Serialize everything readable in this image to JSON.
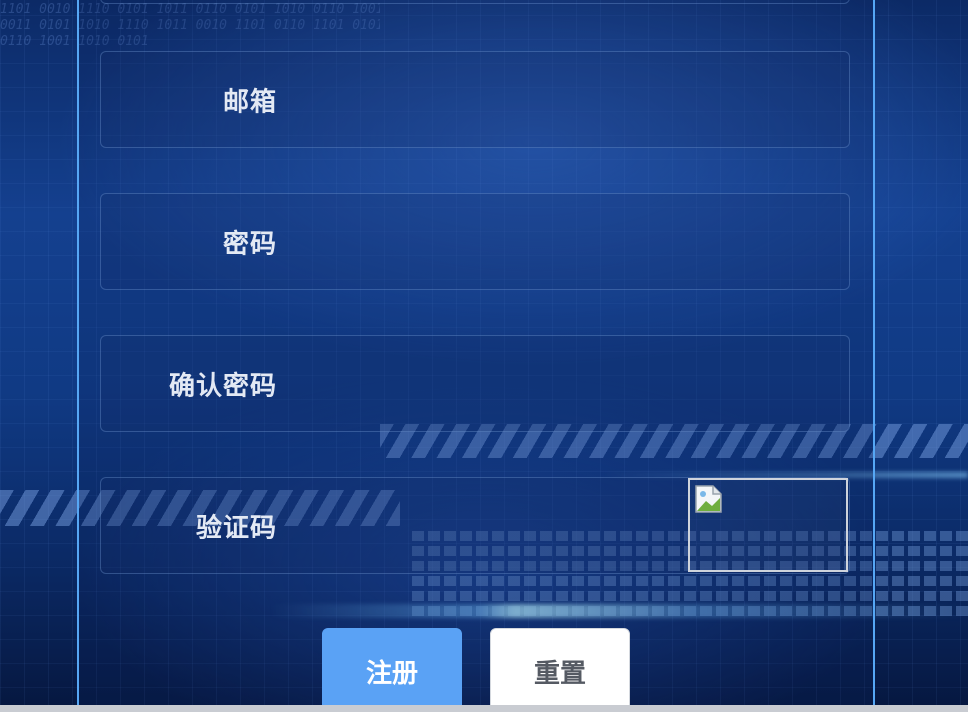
{
  "form": {
    "fields": [
      {
        "label": "邮箱",
        "value": ""
      },
      {
        "label": "密码",
        "value": ""
      },
      {
        "label": "确认密码",
        "value": ""
      },
      {
        "label": "验证码",
        "value": ""
      }
    ],
    "captcha_icon": "broken-image-icon"
  },
  "buttons": {
    "register_label": "注册",
    "reset_label": "重置"
  },
  "colors": {
    "accent": "#5aa2f5",
    "panel_border": "#56a7f5",
    "label_text": "#e3e9f4"
  }
}
